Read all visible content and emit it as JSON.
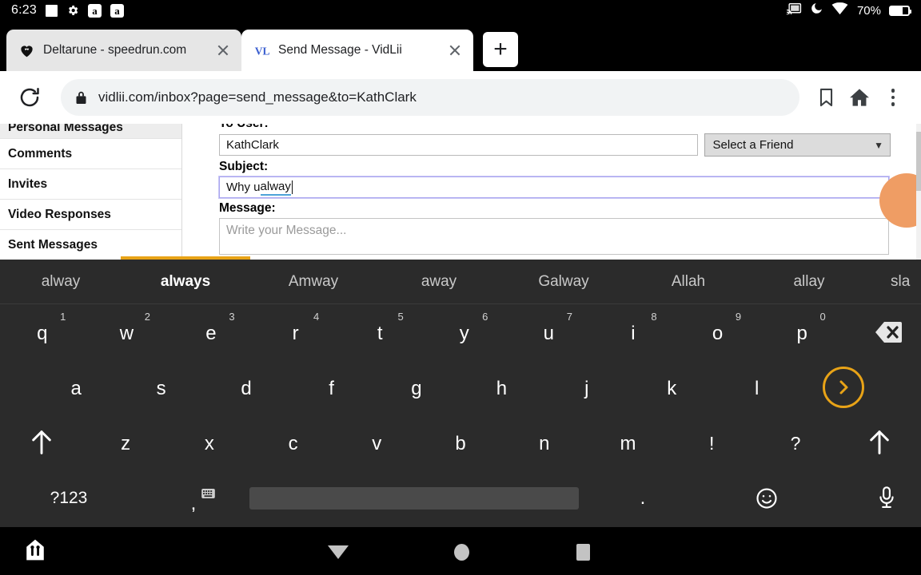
{
  "status_bar": {
    "time": "6:23",
    "icons_left": [
      "square-icon",
      "gear-icon",
      "amazon-icon",
      "amazon-icon"
    ],
    "amazon_letter": "a",
    "icons_right": [
      "cast-icon",
      "do-not-disturb-moon-icon",
      "wifi-icon"
    ],
    "battery_text": "70%"
  },
  "browser": {
    "tabs": [
      {
        "title": "Deltarune - speedrun.com",
        "favicon": "speedrun-heart-icon",
        "active": false
      },
      {
        "title": "Send Message - VidLii",
        "favicon": "vidlii-vl-icon",
        "active": true
      }
    ],
    "new_tab_label": "+",
    "omnibox": {
      "reload_icon": "reload-icon",
      "lock_icon": "lock-icon",
      "url": "vidlii.com/inbox?page=send_message&to=KathClark",
      "bookmark_icon": "bookmark-icon",
      "home_icon": "home-icon",
      "menu_icon": "three-dot-menu-icon"
    }
  },
  "page": {
    "sidebar": {
      "items": [
        {
          "label": "Personal Messages",
          "current": true
        },
        {
          "label": "Comments",
          "current": false
        },
        {
          "label": "Invites",
          "current": false
        },
        {
          "label": "Video Responses",
          "current": false
        },
        {
          "label": "Sent Messages",
          "current": false
        }
      ]
    },
    "form": {
      "to_label": "To User:",
      "to_value": "KathClark",
      "friend_select_value": "Select a Friend",
      "friend_select_chevron": "chevron-down-icon",
      "subject_label": "Subject:",
      "subject_value_plain": "Why u ",
      "subject_value_misspelled": "alway",
      "message_label": "Message:",
      "message_placeholder": "Write your Message..."
    }
  },
  "keyboard": {
    "suggestions": [
      {
        "word": "alway",
        "strong": false
      },
      {
        "word": "always",
        "strong": true
      },
      {
        "word": "Amway",
        "strong": false
      },
      {
        "word": "away",
        "strong": false
      },
      {
        "word": "Galway",
        "strong": false
      },
      {
        "word": "Allah",
        "strong": false
      },
      {
        "word": "allay",
        "strong": false
      },
      {
        "word": "sla",
        "strong": false
      }
    ],
    "row1": [
      {
        "key": "q",
        "sup": "1"
      },
      {
        "key": "w",
        "sup": "2"
      },
      {
        "key": "e",
        "sup": "3"
      },
      {
        "key": "r",
        "sup": "4"
      },
      {
        "key": "t",
        "sup": "5"
      },
      {
        "key": "y",
        "sup": "6"
      },
      {
        "key": "u",
        "sup": "7"
      },
      {
        "key": "i",
        "sup": "8"
      },
      {
        "key": "o",
        "sup": "9"
      },
      {
        "key": "p",
        "sup": "0"
      }
    ],
    "backspace_icon": "backspace-icon",
    "row2": [
      "a",
      "s",
      "d",
      "f",
      "g",
      "h",
      "j",
      "k",
      "l"
    ],
    "enter_icon": "enter-chevron-right-icon",
    "row3_shift_left_icon": "shift-up-arrow-icon",
    "row3": [
      "z",
      "x",
      "c",
      "v",
      "b",
      "n",
      "m",
      "!",
      "?"
    ],
    "row3_shift_right_icon": "shift-up-arrow-icon",
    "symbols_key": "?123",
    "comma_key": ",",
    "comma_top_icon": "keyboard-settings-icon",
    "space_key": "",
    "period_key": ".",
    "emoji_icon": "emoji-smiley-icon",
    "mic_icon": "microphone-icon"
  },
  "navbar": {
    "keyboard_switch_icon": "keyboard-switch-icon",
    "back_icon": "dismiss-keyboard-down-icon",
    "home_icon": "home-circle-icon",
    "recents_icon": "recents-square-icon"
  }
}
